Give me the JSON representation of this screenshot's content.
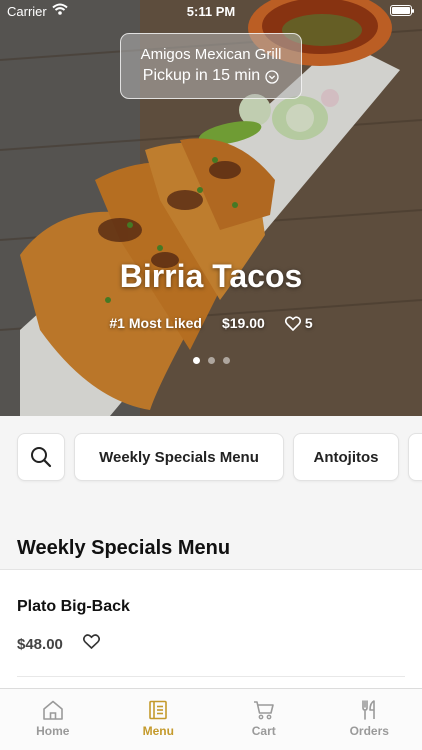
{
  "status_bar": {
    "carrier": "Carrier",
    "time": "5:11 PM"
  },
  "pickup": {
    "restaurant": "Amigos Mexican Grill",
    "eta": "Pickup in 15 min"
  },
  "hero": {
    "title": "Birria Tacos",
    "rank": "#1 Most Liked",
    "price": "$19.00",
    "likes": "5",
    "slides": 3,
    "active_slide": 0
  },
  "categories": [
    "Weekly Specials Menu",
    "Antojitos"
  ],
  "section": {
    "title": "Weekly Specials Menu"
  },
  "items": [
    {
      "name": "Plato Big-Back",
      "price": "$48.00"
    }
  ],
  "tabs": [
    {
      "label": "Home",
      "icon": "home-icon",
      "active": false
    },
    {
      "label": "Menu",
      "icon": "menu-icon",
      "active": true
    },
    {
      "label": "Cart",
      "icon": "cart-icon",
      "active": false
    },
    {
      "label": "Orders",
      "icon": "orders-icon",
      "active": false
    }
  ],
  "colors": {
    "accent": "#c49a2c",
    "inactive": "#9a9a9a",
    "background": "#f5f5f5"
  }
}
